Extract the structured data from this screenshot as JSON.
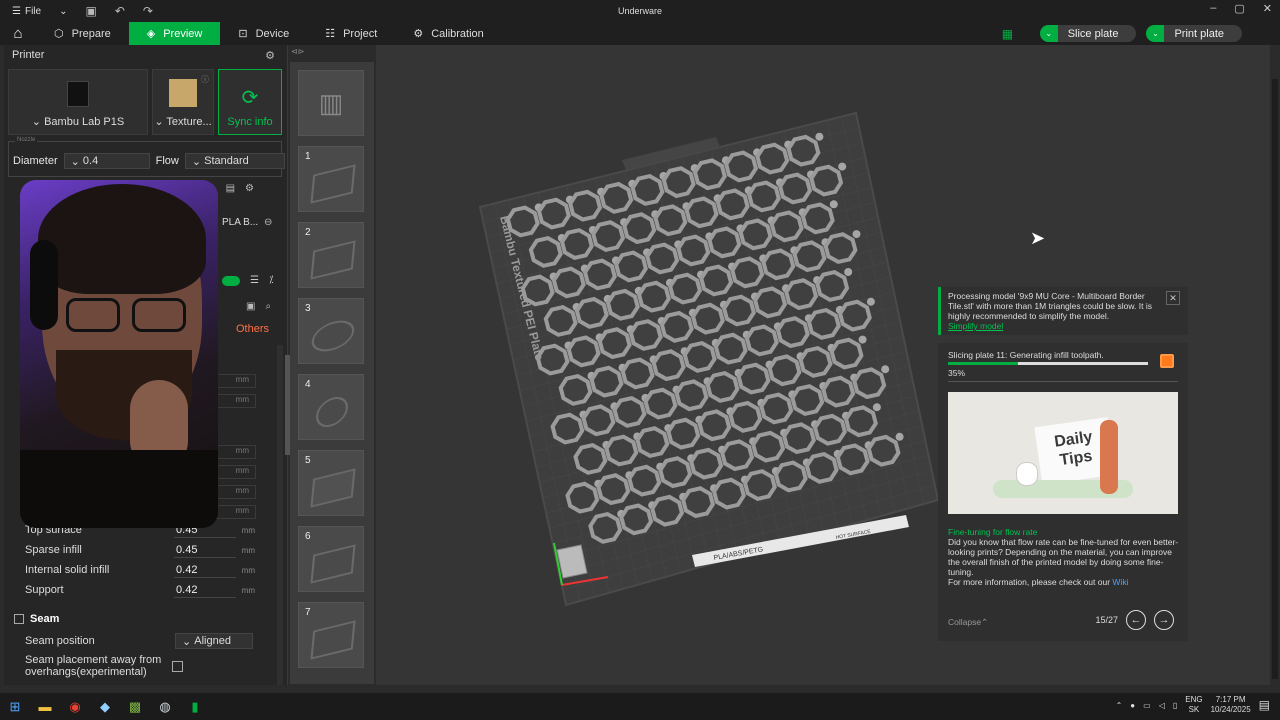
{
  "window": {
    "title": "Underware",
    "file_label": "File"
  },
  "tabs": [
    {
      "label": "Prepare",
      "icon": "prepare-icon"
    },
    {
      "label": "Preview",
      "icon": "layers-icon",
      "active": true
    },
    {
      "label": "Device",
      "icon": "device-icon"
    },
    {
      "label": "Project",
      "icon": "project-icon"
    },
    {
      "label": "Calibration",
      "icon": "calibration-icon"
    }
  ],
  "actions": {
    "slice": "Slice plate",
    "print": "Print plate"
  },
  "printer": {
    "section": "Printer",
    "model": "Bambu Lab P1S",
    "plate": "Texture...",
    "sync": "Sync info",
    "nozzle_caption": "Nozzle",
    "diameter_label": "Diameter",
    "diameter_value": "0.4",
    "flow_label": "Flow",
    "flow_value": "Standard"
  },
  "filament": {
    "preset_partial": "PLA B..."
  },
  "process": {
    "others_tab": "Others",
    "unit": "mm"
  },
  "line_width": [
    {
      "name": "Top surface",
      "value": "0.45"
    },
    {
      "name": "Sparse infill",
      "value": "0.45"
    },
    {
      "name": "Internal solid infill",
      "value": "0.42"
    },
    {
      "name": "Support",
      "value": "0.42"
    }
  ],
  "seam": {
    "section": "Seam",
    "position_label": "Seam position",
    "position_value": "Aligned",
    "away_label_1": "Seam placement away from",
    "away_label_2": "overhangs(experimental)"
  },
  "plates": [
    "1",
    "2",
    "3",
    "4",
    "5",
    "6",
    "7"
  ],
  "bed": {
    "label": "Bambu Textured PEI Plate",
    "strip_text": "PLA/ABS/PETG",
    "logo_text": "HOT SURFACE"
  },
  "notice": {
    "text": "Processing model '9x9 MU Core - Multiboard Border Tile.stl' with more than 1M triangles could be slow. It is highly recommended to simplify the model.",
    "link": "Simplify model"
  },
  "progress": {
    "status": "Slicing plate 11: Generating infill toolpath.",
    "percent_text": "35%",
    "percent": 35,
    "tip_card_line1": "Daily",
    "tip_card_line2": "Tips",
    "tip_title": "Fine-tuning for flow rate",
    "tip_body": "Did you know that flow rate can be fine-tuned for even better-looking prints? Depending on the material, you can improve the overall finish of the printed model by doing some fine-tuning.",
    "tip_more": "For more information, please check out our ",
    "wiki": "Wiki",
    "collapse": "Collapse",
    "page": "15/27"
  },
  "taskbar": {
    "lang1": "ENG",
    "lang2": "SK",
    "time": "7:17 PM",
    "date": "10/24/2025"
  },
  "colors": {
    "accent": "#00ae42",
    "stop": "#ff7a1a",
    "warning_tab": "#ff7043"
  }
}
